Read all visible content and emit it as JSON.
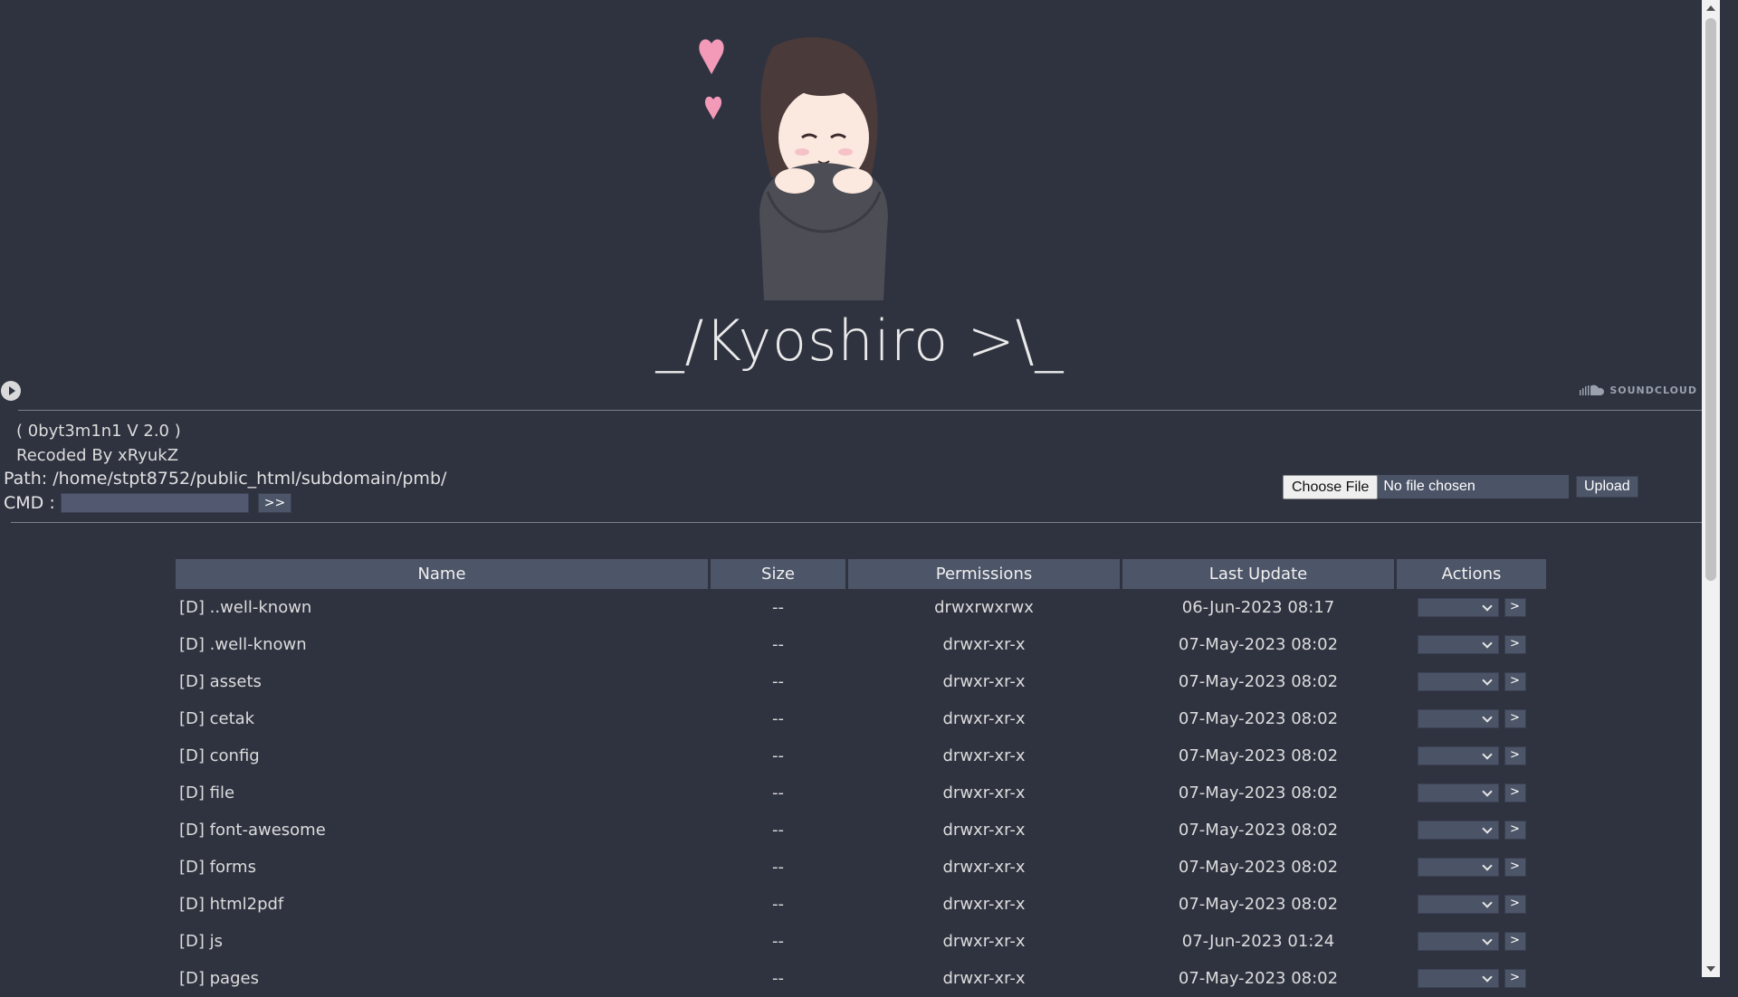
{
  "header": {
    "title": "_/Kyoshiro >\\_",
    "soundcloud_label": "SOUNDCLOUD"
  },
  "info": {
    "version": "( 0byt3m1n1 V 2.0 )",
    "recoded_by": "Recoded By xRyukZ",
    "path_label": "Path:",
    "path_value": "/home/stpt8752/public_html/subdomain/pmb/",
    "cmd_label": "CMD :",
    "cmd_value": "",
    "cmd_button": ">>"
  },
  "upload": {
    "choose_label": "Choose File",
    "file_status": "No file chosen",
    "upload_button": "Upload"
  },
  "table": {
    "headers": [
      "Name",
      "Size",
      "Permissions",
      "Last Update",
      "Actions"
    ],
    "rows": [
      {
        "name": "[D] ..well-known",
        "size": "--",
        "perms": "drwxrwxrwx",
        "updated": "06-Jun-2023 08:17"
      },
      {
        "name": "[D] .well-known",
        "size": "--",
        "perms": "drwxr-xr-x",
        "updated": "07-May-2023 08:02"
      },
      {
        "name": "[D] assets",
        "size": "--",
        "perms": "drwxr-xr-x",
        "updated": "07-May-2023 08:02"
      },
      {
        "name": "[D] cetak",
        "size": "--",
        "perms": "drwxr-xr-x",
        "updated": "07-May-2023 08:02"
      },
      {
        "name": "[D] config",
        "size": "--",
        "perms": "drwxr-xr-x",
        "updated": "07-May-2023 08:02"
      },
      {
        "name": "[D] file",
        "size": "--",
        "perms": "drwxr-xr-x",
        "updated": "07-May-2023 08:02"
      },
      {
        "name": "[D] font-awesome",
        "size": "--",
        "perms": "drwxr-xr-x",
        "updated": "07-May-2023 08:02"
      },
      {
        "name": "[D] forms",
        "size": "--",
        "perms": "drwxr-xr-x",
        "updated": "07-May-2023 08:02"
      },
      {
        "name": "[D] html2pdf",
        "size": "--",
        "perms": "drwxr-xr-x",
        "updated": "07-May-2023 08:02"
      },
      {
        "name": "[D] js",
        "size": "--",
        "perms": "drwxr-xr-x",
        "updated": "07-Jun-2023 01:24"
      },
      {
        "name": "[D] pages",
        "size": "--",
        "perms": "drwxr-xr-x",
        "updated": "07-May-2023 08:02"
      }
    ],
    "action_button": ">"
  }
}
